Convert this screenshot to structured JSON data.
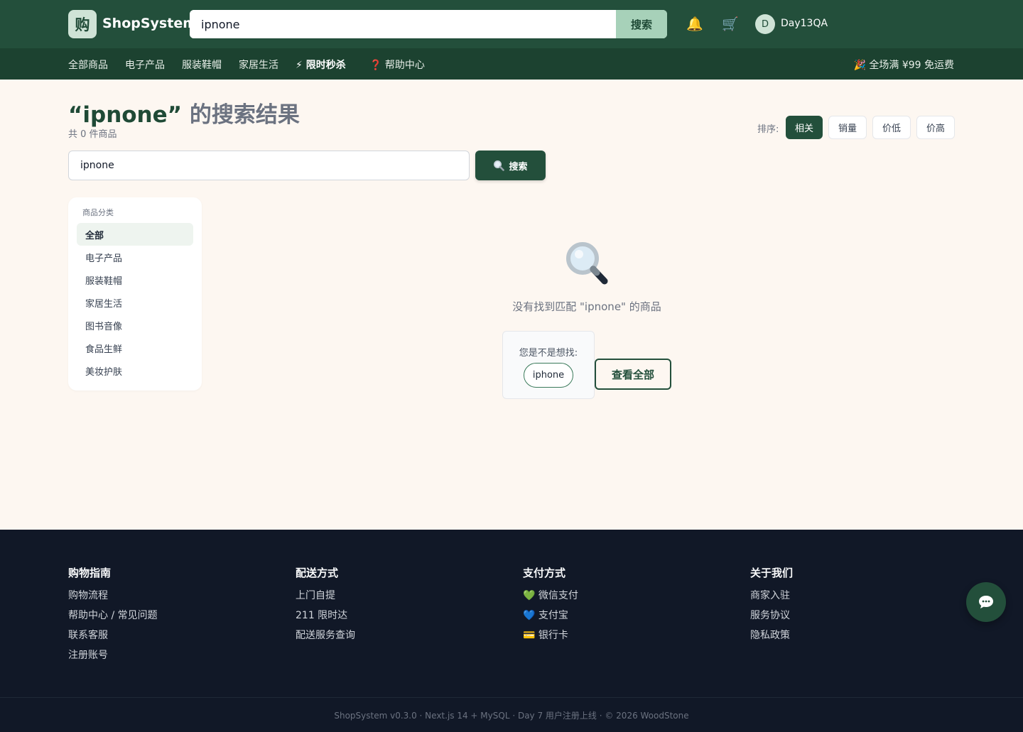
{
  "header": {
    "logo_char": "购",
    "brand": "ShopSystem",
    "search_value": "ipnone",
    "search_button": "搜索",
    "bell_icon": "🔔",
    "cart_icon": "🛒",
    "avatar_initial": "D",
    "username": "Day13QA"
  },
  "nav": {
    "items": [
      "全部商品",
      "电子产品",
      "服装鞋帽",
      "家居生活",
      "⚡ 限时秒杀",
      "❓ 帮助中心"
    ],
    "promo": "🎉 全场满 ¥99 免运费"
  },
  "results": {
    "title_prefix": "“ipnone”",
    "title_suffix": " 的搜索结果",
    "count": "共 0 件商品",
    "search_value": "ipnone",
    "search_button": "搜索"
  },
  "sort": {
    "label": "排序:",
    "options": [
      "相关",
      "销量",
      "价低",
      "价高"
    ],
    "active": "相关"
  },
  "categories": {
    "title": "商品分类",
    "items": [
      "全部",
      "电子产品",
      "服装鞋帽",
      "家居生活",
      "图书音像",
      "食品生鲜",
      "美妆护肤"
    ],
    "active": "全部"
  },
  "empty": {
    "message": "没有找到匹配 \"ipnone\" 的商品",
    "suggest_label": "您是不是想找:",
    "suggestion": "iphone",
    "view_all": "查看全部"
  },
  "footer": {
    "columns": [
      {
        "title": "购物指南",
        "links": [
          "购物流程",
          "帮助中心 / 常见问题",
          "联系客服",
          "注册账号"
        ]
      },
      {
        "title": "配送方式",
        "links": [
          "上门自提",
          "211 限时达",
          "配送服务查询"
        ]
      },
      {
        "title": "支付方式",
        "links": [
          "💚 微信支付",
          "💙 支付宝",
          "💳 银行卡"
        ]
      },
      {
        "title": "关于我们",
        "links": [
          "商家入驻",
          "服务协议",
          "隐私政策"
        ]
      }
    ],
    "copyright": "ShopSystem v0.3.0 · Next.js 14 + MySQL · Day 7 用户注册上线 · © 2026 WoodStone"
  },
  "colors": {
    "brand_dark": "#234f3b",
    "nav_bg": "#1c4230",
    "accent_light": "#a7d1b9",
    "page_bg": "#fdf7f1",
    "footer_bg": "#111827"
  },
  "icons": {
    "search": "magnifier-icon",
    "chat": "chat-bubble-icon"
  }
}
